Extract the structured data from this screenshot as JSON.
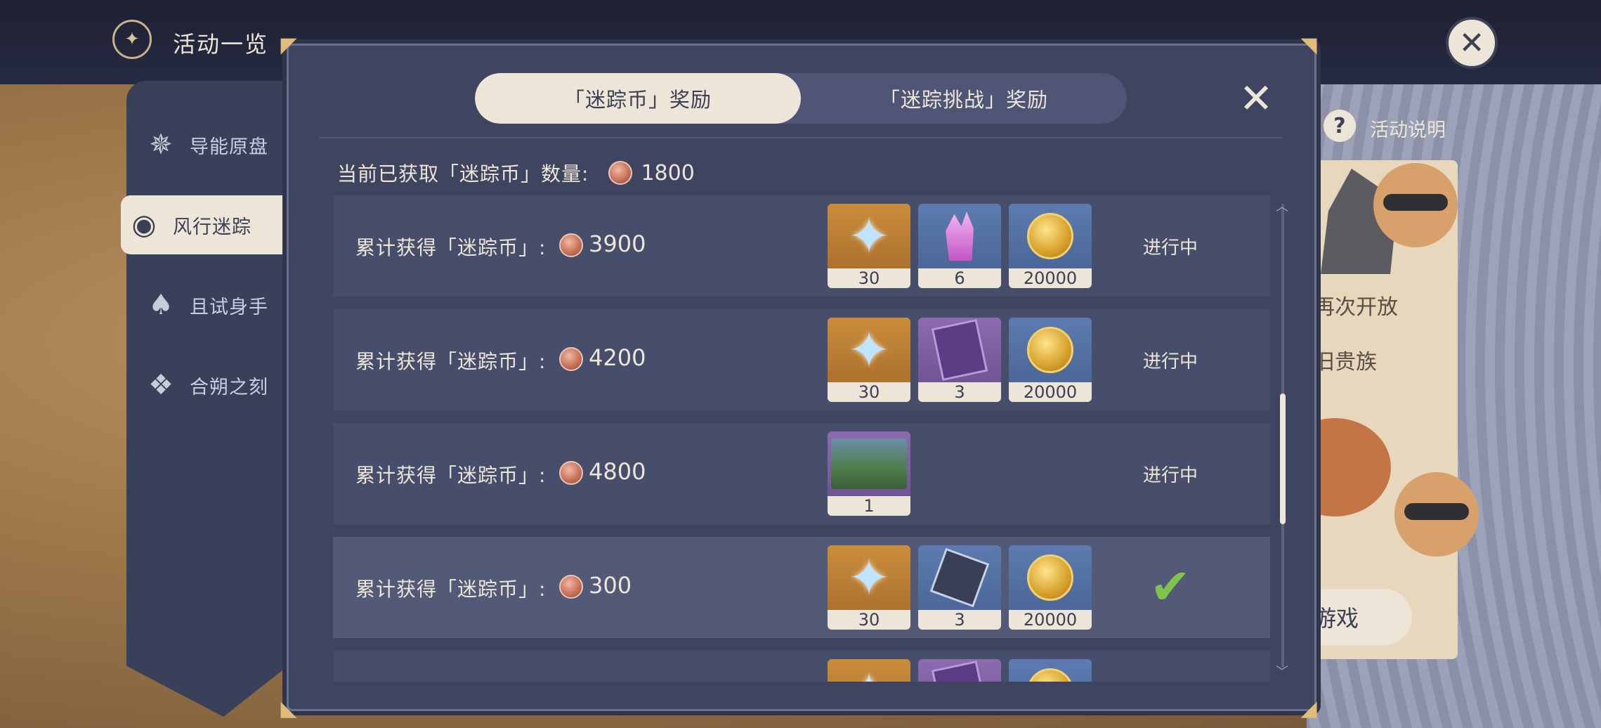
{
  "header": {
    "title": "活动一览"
  },
  "sidebar": {
    "items": [
      {
        "label": "导能原盘",
        "icon": "compass-icon"
      },
      {
        "label": "风行迷踪",
        "icon": "cat-mask-icon",
        "active": true
      },
      {
        "label": "且试身手",
        "icon": "cards-icon"
      },
      {
        "label": "合朔之刻",
        "icon": "lantern-icon"
      }
    ]
  },
  "side_panel": {
    "help_label": "活动说明",
    "text_1": "再次开放",
    "text_2": "旧贵族",
    "play_button": "游戏"
  },
  "dialog": {
    "tabs": [
      {
        "label": "「迷踪币」奖励",
        "active": true
      },
      {
        "label": "「迷踪挑战」奖励",
        "active": false
      }
    ],
    "current_label": "当前已获取「迷踪币」数量:",
    "current_value": "1800",
    "rows": [
      {
        "label": "累计获得「迷踪币」:",
        "value": "3900",
        "rewards": [
          {
            "icon": "primogem-icon",
            "qty": "30"
          },
          {
            "icon": "crystal-icon",
            "qty": "6"
          },
          {
            "icon": "mora-icon",
            "qty": "20000"
          }
        ],
        "status": "进行中",
        "completed": false
      },
      {
        "label": "累计获得「迷踪币」:",
        "value": "4200",
        "rewards": [
          {
            "icon": "primogem-icon",
            "qty": "30"
          },
          {
            "icon": "talent-book-icon",
            "qty": "3"
          },
          {
            "icon": "mora-icon",
            "qty": "20000"
          }
        ],
        "status": "进行中",
        "completed": false
      },
      {
        "label": "累计获得「迷踪币」:",
        "value": "4800",
        "rewards": [
          {
            "icon": "namecard-icon",
            "qty": "1"
          }
        ],
        "status": "进行中",
        "completed": false
      },
      {
        "label": "累计获得「迷踪币」:",
        "value": "300",
        "rewards": [
          {
            "icon": "primogem-icon",
            "qty": "30"
          },
          {
            "icon": "weapon-ore-icon",
            "qty": "3"
          },
          {
            "icon": "mora-icon",
            "qty": "20000"
          }
        ],
        "status": "",
        "completed": true
      }
    ]
  },
  "colors": {
    "cream": "#ece5d8",
    "panel": "#3f4561",
    "row": "#474e6b",
    "check": "#7ec34a",
    "gold_corner": "#e0bc78"
  }
}
